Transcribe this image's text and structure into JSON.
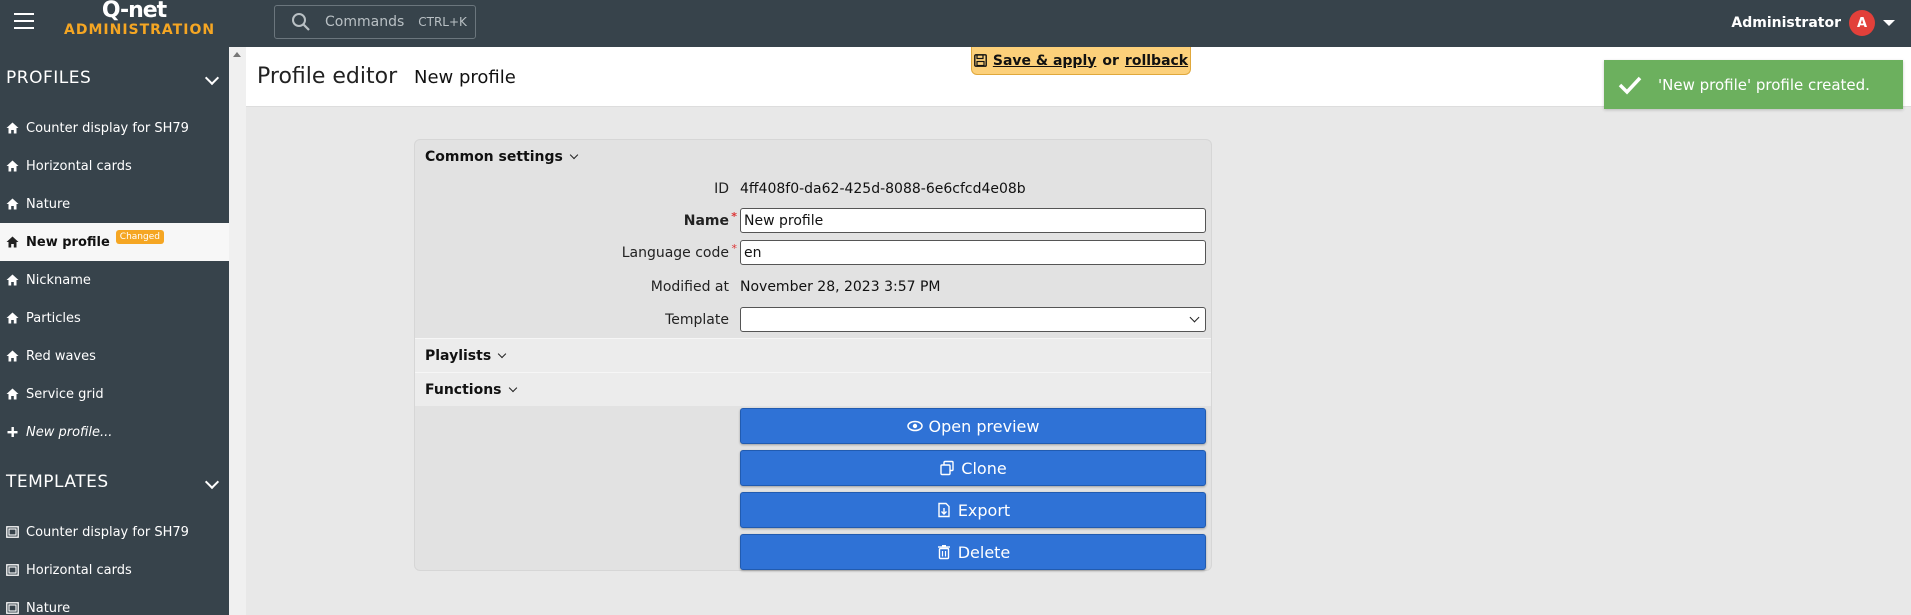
{
  "topbar": {
    "brand": "Q-net",
    "brand_sub": "ADMINISTRATION",
    "commands_label": "Commands",
    "commands_shortcut": "CTRL+K",
    "user_name": "Administrator",
    "user_initial": "A"
  },
  "sidebar": {
    "profiles_title": "PROFILES",
    "profiles": [
      {
        "label": "Counter display for SH79"
      },
      {
        "label": "Horizontal cards"
      },
      {
        "label": "Nature"
      },
      {
        "label": "New profile",
        "badge": "Changed",
        "active": true
      },
      {
        "label": "Nickname"
      },
      {
        "label": "Particles"
      },
      {
        "label": "Red waves"
      },
      {
        "label": "Service grid"
      }
    ],
    "new_profile_label": "New profile...",
    "templates_title": "TEMPLATES",
    "templates": [
      {
        "label": "Counter display for SH79"
      },
      {
        "label": "Horizontal cards"
      },
      {
        "label": "Nature"
      }
    ]
  },
  "header": {
    "title": "Profile editor",
    "subtitle": "New profile"
  },
  "savebar": {
    "save_label": "Save & apply",
    "or_label": "or",
    "rollback_label": "rollback"
  },
  "toast": {
    "message": "'New profile' profile created."
  },
  "editor": {
    "common_settings_label": "Common settings",
    "id_label": "ID",
    "id_value": "4ff408f0-da62-425d-8088-6e6cfcd4e08b",
    "name_label": "Name",
    "name_value": "New profile",
    "language_label": "Language code",
    "language_value": "en",
    "modified_label": "Modified at",
    "modified_value": "November 28, 2023 3:57 PM",
    "template_label": "Template",
    "template_value": "",
    "playlists_label": "Playlists",
    "functions_label": "Functions",
    "open_preview_label": "Open preview",
    "clone_label": "Clone",
    "export_label": "Export",
    "delete_label": "Delete"
  },
  "colors": {
    "topbar": "#37434b",
    "accent_orange": "#f5a623",
    "button_blue": "#2f72d6",
    "toast_green": "#6cb05e",
    "savebar_yellow": "#fcd07a"
  }
}
